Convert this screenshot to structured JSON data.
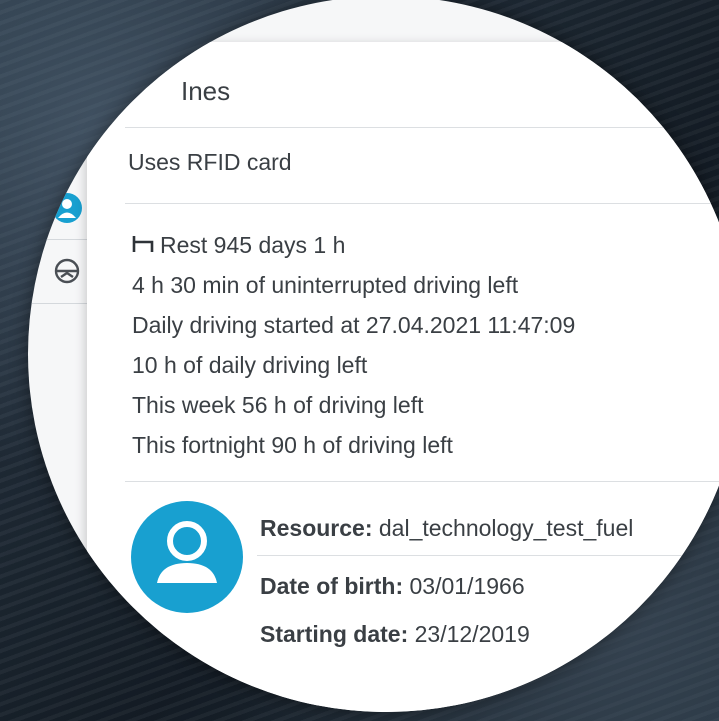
{
  "driver": {
    "name": "Ines",
    "rfid_text": "Uses RFID card"
  },
  "status": {
    "rest": "Rest 945 days 1 h",
    "uninterrupted": "4 h 30 min of uninterrupted driving left",
    "daily_started": "Daily driving started at 27.04.2021 11:47:09",
    "daily_left": "10 h of daily driving left",
    "week_left": "This week 56 h of driving left",
    "fortnight_left": "This fortnight 90 h of driving left"
  },
  "details": {
    "resource_label": "Resource:",
    "resource_value": " dal_technology_test_fuel",
    "birth_label": "Date of birth:",
    "birth_value": " 03/01/1966",
    "start_label": "Starting date:",
    "start_value": " 23/12/2019"
  },
  "colors": {
    "accent": "#18a0d0",
    "text": "#3a3f44",
    "divider": "#dcdfe2"
  },
  "icons": {
    "rest": "bed-icon",
    "avatar": "user-avatar-icon",
    "background_row_1": "user-icon",
    "background_row_2": "steering-wheel-icon"
  }
}
